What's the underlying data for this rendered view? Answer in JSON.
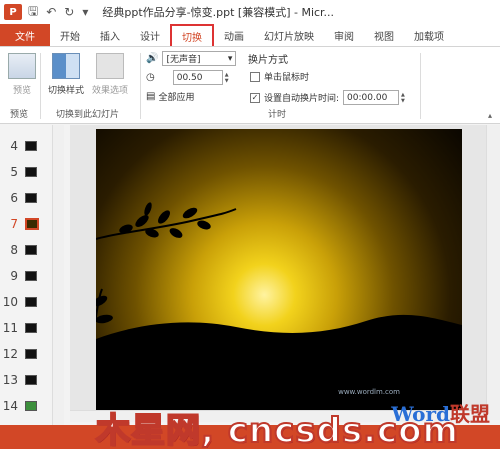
{
  "app": {
    "icon_letter": "P",
    "title": "经典ppt作品分享-惊变.ppt [兼容模式] - Micr..."
  },
  "tabs": [
    "文件",
    "开始",
    "插入",
    "设计",
    "切换",
    "动画",
    "幻灯片放映",
    "审阅",
    "视图",
    "加载项"
  ],
  "ribbon": {
    "preview": {
      "label": "预览",
      "group": "预览"
    },
    "switch_style": "切换样式",
    "effect_options": "效果选项",
    "group_switch": "切换到此幻灯片",
    "sound": "[无声音]",
    "duration": "00.50",
    "apply_all": "全部应用",
    "advance_title": "换片方式",
    "on_click": "单击鼠标时",
    "auto_after": "设置自动换片时间:",
    "auto_time": "00:00.00",
    "group_timing": "计时"
  },
  "slides": [
    {
      "num": "4",
      "style": "dark"
    },
    {
      "num": "5",
      "style": "dark"
    },
    {
      "num": "6",
      "style": "dark"
    },
    {
      "num": "7",
      "style": "selected"
    },
    {
      "num": "8",
      "style": "dark"
    },
    {
      "num": "9",
      "style": "dark"
    },
    {
      "num": "10",
      "style": "dark"
    },
    {
      "num": "11",
      "style": "dark"
    },
    {
      "num": "12",
      "style": "dark"
    },
    {
      "num": "13",
      "style": "dark"
    },
    {
      "num": "14",
      "style": "green"
    }
  ],
  "watermark": {
    "word": "Word",
    "lianmeng": "联盟",
    "url": "www.wordlm.com"
  },
  "brand": "木星网, cncsds.com",
  "colors": {
    "accent": "#d24726",
    "active_tab_border": "#dd3333"
  }
}
